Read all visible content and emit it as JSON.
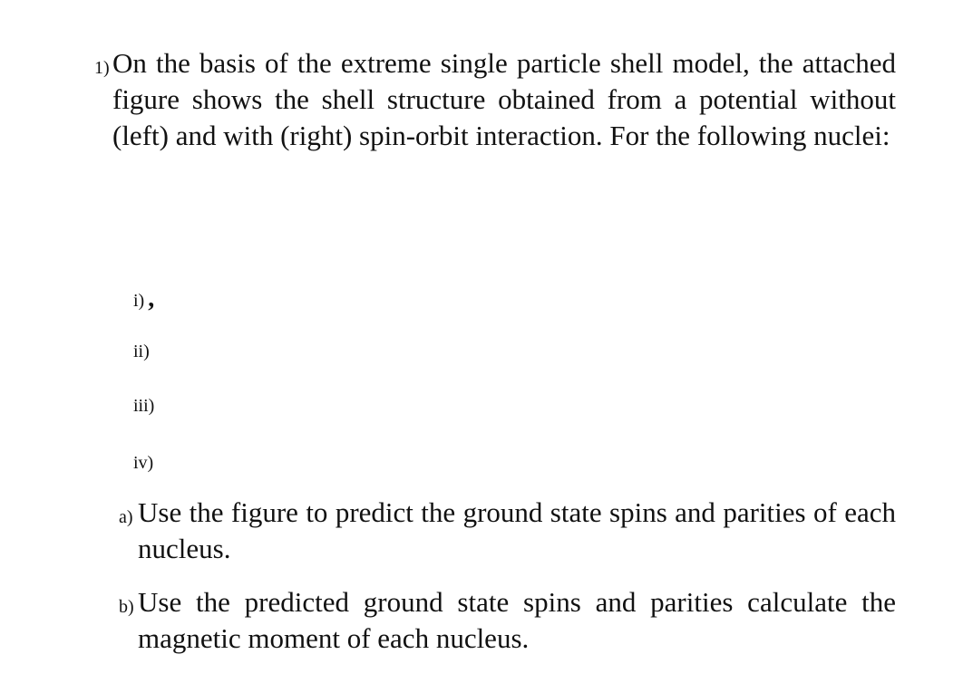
{
  "question": {
    "marker": "1)",
    "text": "On the basis of the extreme single particle shell model, the attached figure shows the shell structure obtained from a potential without (left) and with (right) spin-orbit interaction. For the following nuclei:"
  },
  "nuclei": [
    {
      "marker": "i)",
      "extra": ","
    },
    {
      "marker": "ii)",
      "extra": ""
    },
    {
      "marker": "iii)",
      "extra": ""
    },
    {
      "marker": "iv)",
      "extra": ""
    }
  ],
  "parts": [
    {
      "marker": "a)",
      "text": "Use the figure to predict the ground state spins and parities of each nucleus."
    },
    {
      "marker": "b)",
      "text": "Use the predicted ground state spins and parities calculate the magnetic moment of each nucleus."
    }
  ]
}
